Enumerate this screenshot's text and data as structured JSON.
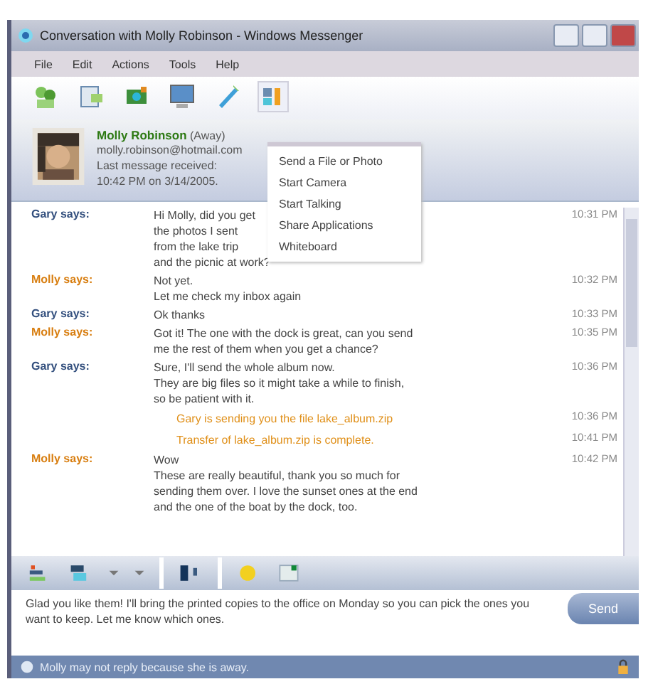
{
  "window": {
    "title": "Conversation with Molly Robinson - Windows Messenger"
  },
  "menu": [
    "File",
    "Edit",
    "Actions",
    "Tools",
    "Help"
  ],
  "dropdown": {
    "items": [
      "Send a File or Photo",
      "Start Camera",
      "Start Talking",
      "Share Applications",
      "Whiteboard"
    ]
  },
  "contact": {
    "name": "Molly Robinson",
    "status": "(Away)",
    "lines": [
      "molly.robinson@hotmail.com",
      "Last message received:",
      "10:42 PM on 3/14/2005."
    ]
  },
  "messages": [
    {
      "kind": "me",
      "sender": "Gary says:",
      "lines": [
        "Hi Molly, did you get",
        "the photos I sent",
        "from the lake trip",
        "and the picnic at work?"
      ],
      "time": "10:31 PM"
    },
    {
      "kind": "them",
      "sender": "Molly says:",
      "lines": [
        "Not yet.",
        "Let me check my inbox again"
      ],
      "time": "10:32 PM"
    },
    {
      "kind": "me",
      "sender": "Gary says:",
      "lines": [
        "Ok thanks"
      ],
      "time": "10:33 PM"
    },
    {
      "kind": "them",
      "sender": "Molly says:",
      "lines": [
        "Got it! The one with the dock is great, can you send",
        "me the rest of them when you get a chance?"
      ],
      "time": "10:35 PM"
    },
    {
      "kind": "me",
      "sender": "Gary says:",
      "lines": [
        "Sure, I'll send the whole album now.",
        "They are big files so it might take a while to finish,",
        "so be patient with it."
      ],
      "time": "10:36 PM"
    },
    {
      "kind": "notice",
      "lines": [
        "Gary is sending you the file lake_album.zip"
      ],
      "time": "10:36 PM"
    },
    {
      "kind": "notice",
      "lines": [
        "Transfer of lake_album.zip is complete."
      ],
      "time": "10:41 PM"
    },
    {
      "kind": "them",
      "sender": "Molly says:",
      "lines": [
        "Wow",
        "These are really beautiful, thank you so much for",
        "sending them over. I love the sunset ones at the end",
        "and the one of the boat by the dock, too."
      ],
      "time": "10:42 PM"
    }
  ],
  "input": {
    "value": "Glad you like them! I'll bring the printed copies to the office on Monday so you can pick the ones you want to keep. Let me know which ones."
  },
  "send_button": "Send",
  "status_bar": "Molly may not reply because she is away."
}
